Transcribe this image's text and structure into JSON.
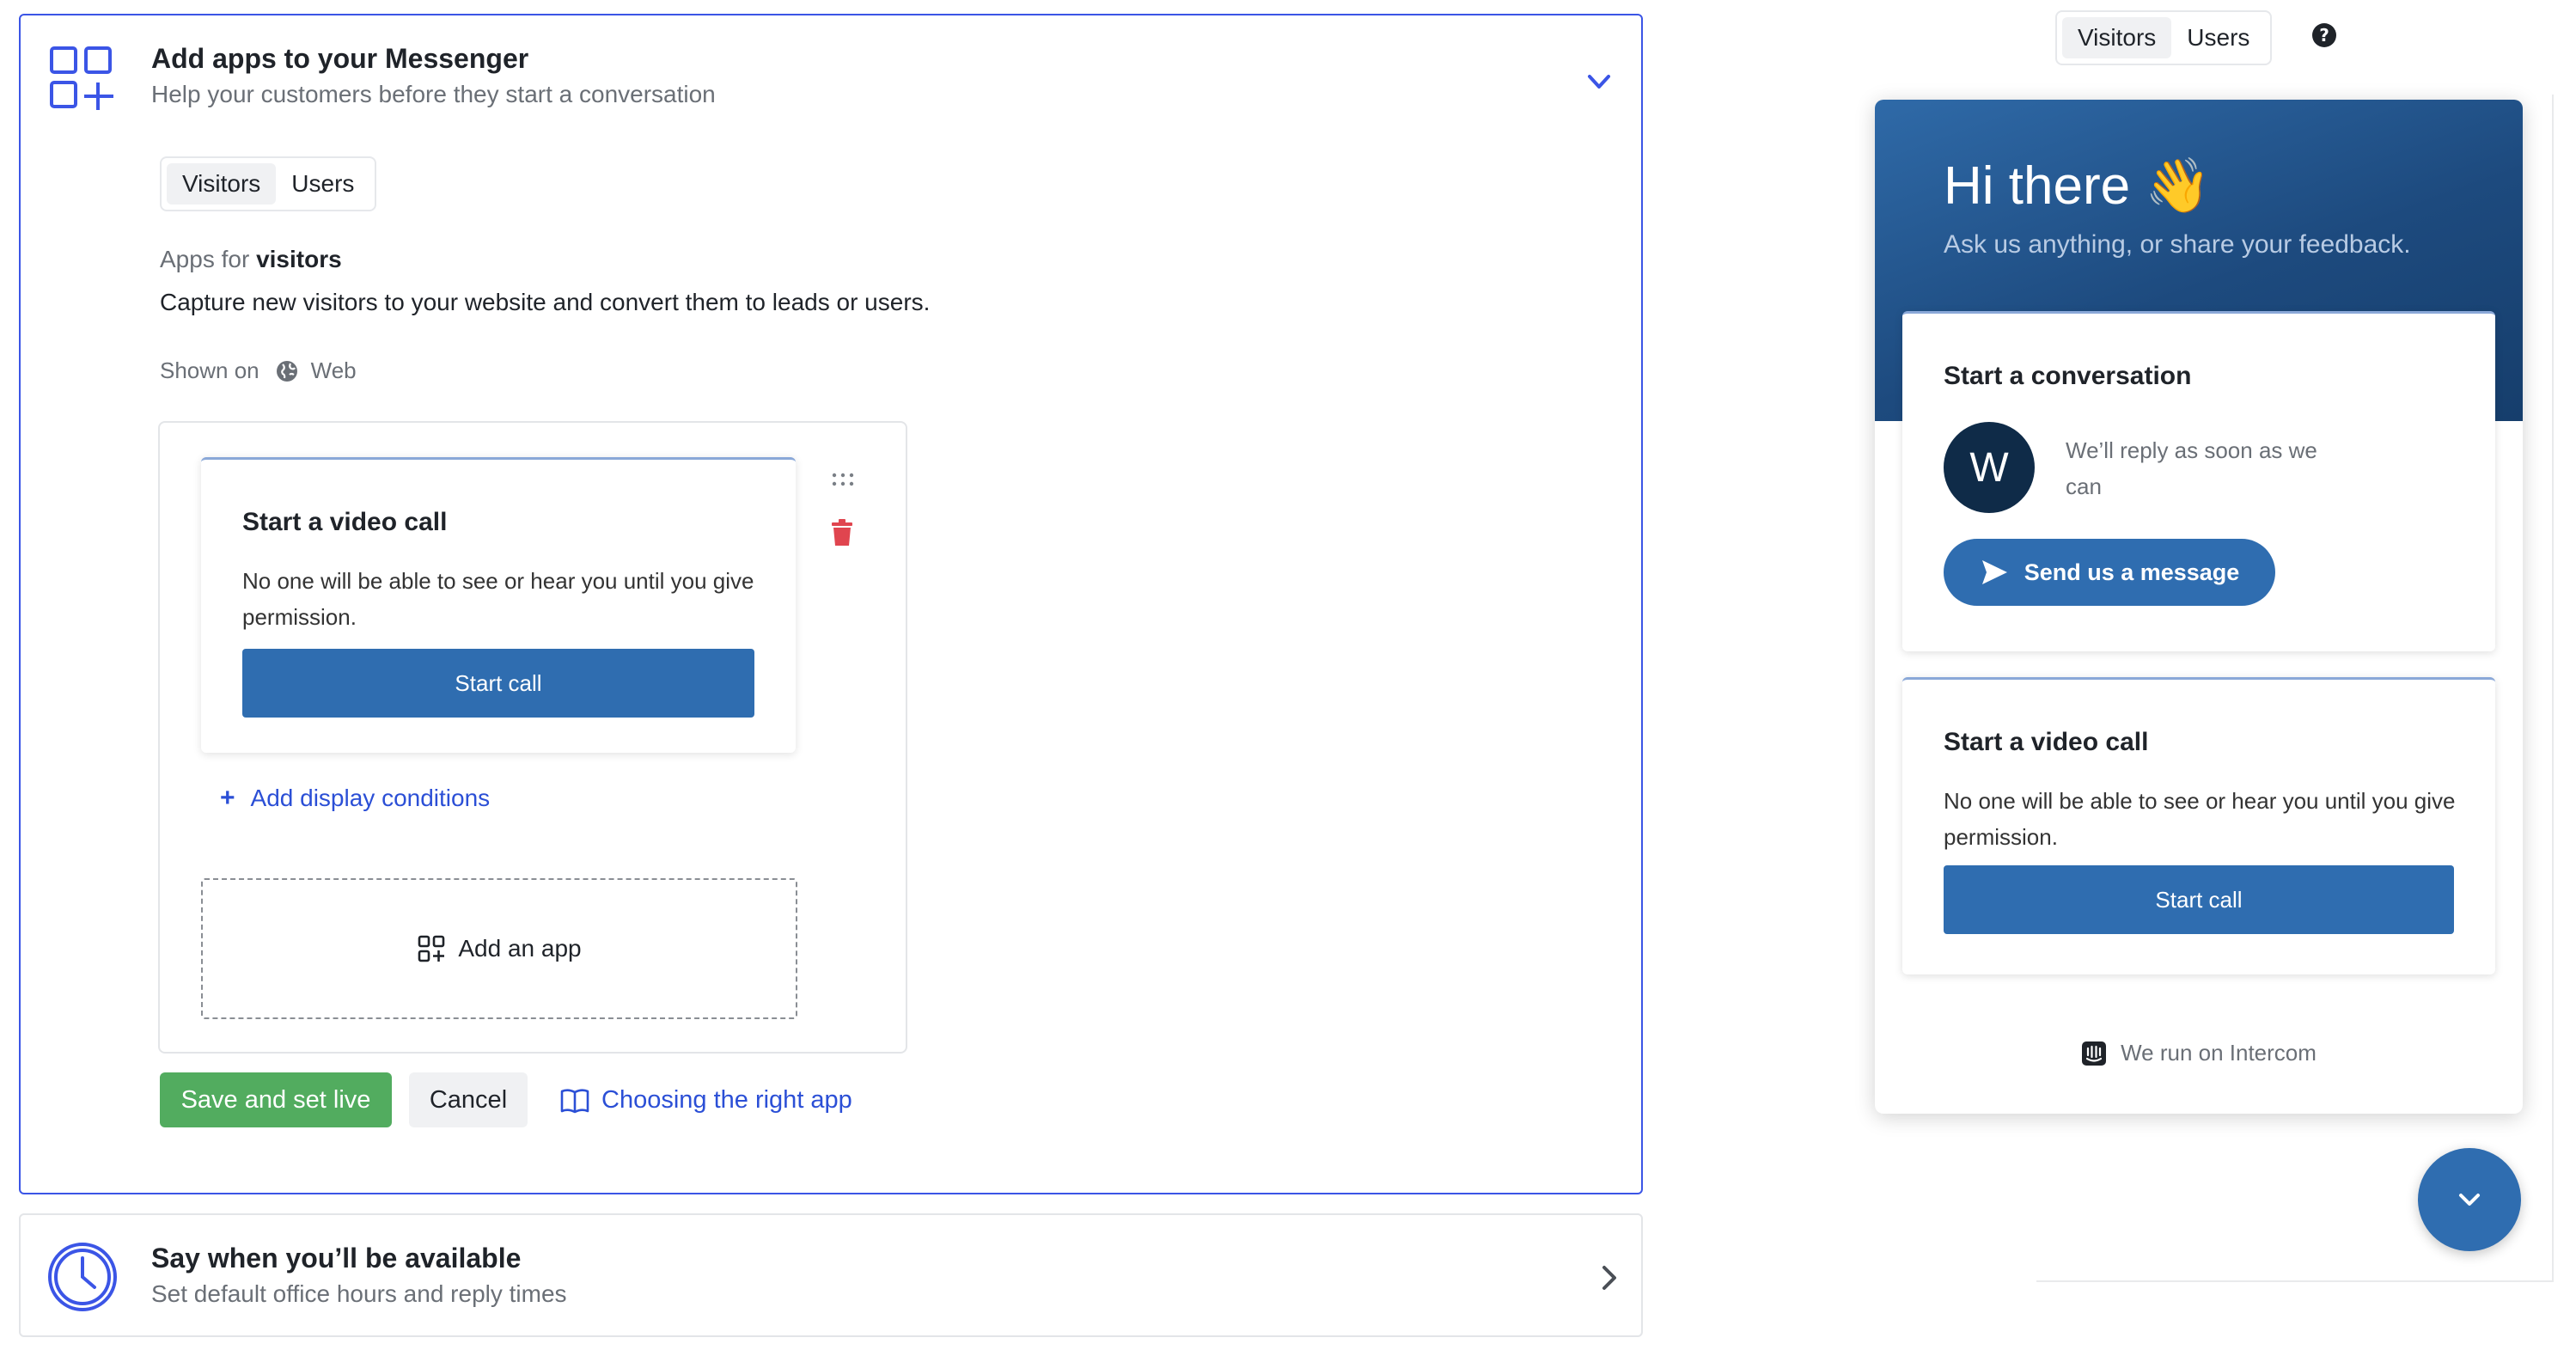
{
  "apps_section": {
    "title": "Add apps to your Messenger",
    "subtitle": "Help your customers before they start a conversation",
    "tabs": [
      {
        "label": "Visitors",
        "active": true
      },
      {
        "label": "Users",
        "active": false
      }
    ],
    "apps_for_prefix": "Apps for",
    "apps_for_target": "visitors",
    "description": "Capture new visitors to your website and convert them to leads or users.",
    "shown_on_label": "Shown on",
    "shown_on_value": "Web",
    "video_card": {
      "title": "Start a video call",
      "text": "No one will be able to see or hear you until you give permission.",
      "button": "Start call"
    },
    "add_conditions": "Add display conditions",
    "add_app": "Add an app",
    "save_button": "Save and set live",
    "cancel_button": "Cancel",
    "help_link": "Choosing the right app"
  },
  "availability_section": {
    "title": "Say when you’ll be available",
    "subtitle": "Set default office hours and reply times"
  },
  "preview": {
    "tabs": [
      {
        "label": "Visitors",
        "active": true
      },
      {
        "label": "Users",
        "active": false
      }
    ],
    "greeting": "Hi there 👋",
    "intro": "Ask us anything, or share your feedback.",
    "conversation_card": {
      "title": "Start a conversation",
      "avatar_letter": "W",
      "reply_text": "We’ll reply as soon as we can",
      "button": "Send us a message"
    },
    "video_card": {
      "title": "Start a video call",
      "text": "No one will be able to see or hear you until you give permission.",
      "button": "Start call"
    },
    "footer": "We run on Intercom"
  },
  "colors": {
    "accent_blue": "#3b55e6",
    "messenger_blue": "#2f6db0",
    "save_green": "#52ac5f",
    "delete_red": "#e0454f"
  }
}
